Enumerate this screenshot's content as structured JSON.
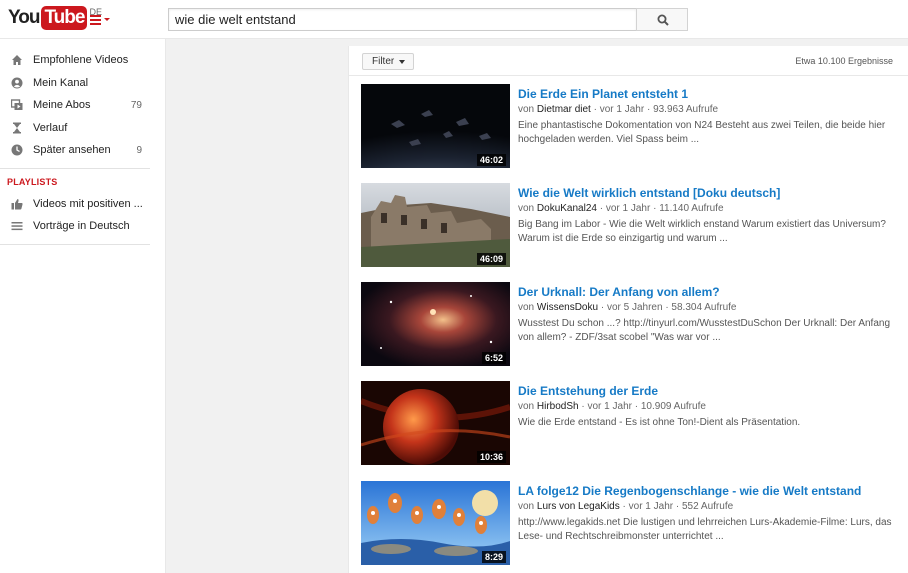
{
  "header": {
    "logo_you": "You",
    "logo_tube": "Tube",
    "logo_country": "DE",
    "search_value": "wie die welt entstand"
  },
  "sidebar": {
    "items": [
      {
        "label": "Empfohlene Videos",
        "icon": "home-icon",
        "count": ""
      },
      {
        "label": "Mein Kanal",
        "icon": "user-icon",
        "count": ""
      },
      {
        "label": "Meine Abos",
        "icon": "subscriptions-icon",
        "count": "79"
      },
      {
        "label": "Verlauf",
        "icon": "history-icon",
        "count": ""
      },
      {
        "label": "Später ansehen",
        "icon": "watch-later-icon",
        "count": "9"
      }
    ],
    "playlists_title": "PLAYLISTS",
    "playlists": [
      {
        "label": "Videos mit positiven ...",
        "icon": "thumbs-up-icon"
      },
      {
        "label": "Vorträge in Deutsch",
        "icon": "playlist-icon"
      }
    ]
  },
  "results_header": {
    "filter_label": "Filter",
    "count_text": "Etwa 10.100 Ergebnisse"
  },
  "results": [
    {
      "title": "Die Erde Ein Planet entsteht 1",
      "by": "von",
      "channel": "Dietmar diet",
      "age": "vor 1 Jahr",
      "views": "93.963 Aufrufe",
      "desc": "Eine phantastische Dokomentation von N24 Besteht aus zwei Teilen, die beide hier hochgeladen werden. Viel Spass beim ...",
      "duration": "46:02"
    },
    {
      "title": "Wie die Welt wirklich entstand [Doku deutsch]",
      "by": "von",
      "channel": "DokuKanal24",
      "age": "vor 1 Jahr",
      "views": "11.140 Aufrufe",
      "desc": "Big Bang im Labor - Wie die Welt wirklich enstand Warum existiert das Universum? Warum ist die Erde so einzigartig und warum ...",
      "duration": "46:09"
    },
    {
      "title": "Der Urknall: Der Anfang von allem?",
      "by": "von",
      "channel": "WissensDoku",
      "age": "vor 5 Jahren",
      "views": "58.304 Aufrufe",
      "desc": "Wusstest Du schon ...? http://tinyurl.com/WusstestDuSchon Der Urknall: Der Anfang von allem? - ZDF/3sat scobel \"Was war vor ...",
      "duration": "6:52"
    },
    {
      "title": "Die Entstehung der Erde",
      "by": "von",
      "channel": "HirbodSh",
      "age": "vor 1 Jahr",
      "views": "10.909 Aufrufe",
      "desc": "Wie die Erde entstand - Es ist ohne Ton!-Dient als Präsentation.",
      "duration": "10:36"
    },
    {
      "title": "LA folge12 Die Regenbogenschlange - wie die Welt entstand",
      "by": "von",
      "channel": "Lurs von LegaKids",
      "age": "vor 1 Jahr",
      "views": "552 Aufrufe",
      "desc": "http://www.legakids.net Die lustigen und lehrreichen Lurs-Akademie-Filme: Lurs, das Lese- und Rechtschreibmonster unterrichtet ...",
      "duration": "8:29"
    }
  ],
  "colors": {
    "brand_red": "#cc181e",
    "link_blue": "#167ac6"
  }
}
